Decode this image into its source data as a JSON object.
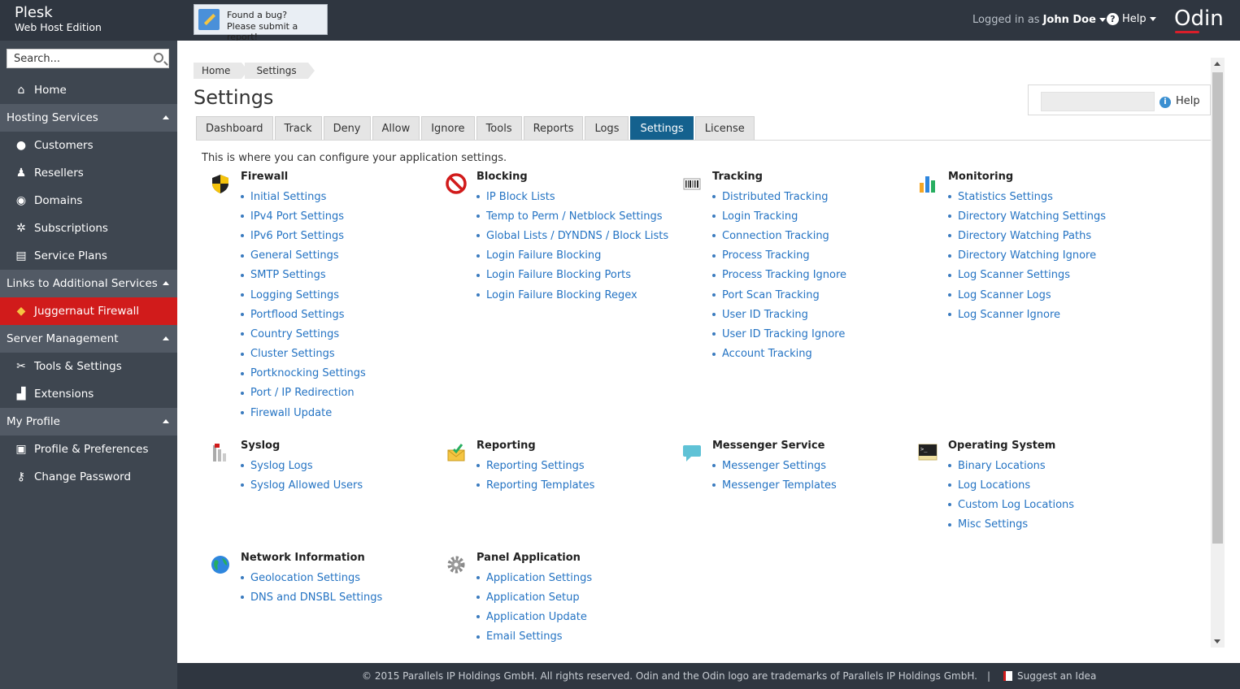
{
  "header": {
    "brand_line1": "Plesk",
    "brand_line2": "Web Host Edition",
    "bug_line1": "Found a bug?",
    "bug_line2": "Please submit a report!",
    "logged_in_as": "Logged in as",
    "user_name": "John Doe",
    "help_label": "Help",
    "logo": "Odin"
  },
  "sidebar": {
    "search_placeholder": "Search...",
    "home": "Home",
    "sections": [
      {
        "label": "Hosting Services",
        "items": [
          "Customers",
          "Resellers",
          "Domains",
          "Subscriptions",
          "Service Plans"
        ]
      },
      {
        "label": "Links to Additional Services",
        "items": [
          "Juggernaut Firewall"
        ]
      },
      {
        "label": "Server Management",
        "items": [
          "Tools & Settings",
          "Extensions"
        ]
      },
      {
        "label": "My Profile",
        "items": [
          "Profile & Preferences",
          "Change Password"
        ]
      }
    ]
  },
  "main": {
    "breadcrumbs": [
      "Home",
      "Settings"
    ],
    "title": "Settings",
    "help_label": "Help",
    "tabs": [
      "Dashboard",
      "Track",
      "Deny",
      "Allow",
      "Ignore",
      "Tools",
      "Reports",
      "Logs",
      "Settings",
      "License"
    ],
    "active_tab": "Settings",
    "intro": "This is where you can configure your application settings.",
    "groups": [
      {
        "title": "Firewall",
        "icon": "shield-icon",
        "links": [
          "Initial Settings",
          "IPv4 Port Settings",
          "IPv6 Port Settings",
          "General Settings",
          "SMTP Settings",
          "Logging Settings",
          "Portflood Settings",
          "Country Settings",
          "Cluster Settings",
          "Portknocking Settings",
          "Port / IP Redirection",
          "Firewall Update"
        ]
      },
      {
        "title": "Blocking",
        "icon": "block-icon",
        "links": [
          "IP Block Lists",
          "Temp to Perm / Netblock Settings",
          "Global Lists / DYNDNS / Block Lists",
          "Login Failure Blocking",
          "Login Failure Blocking Ports",
          "Login Failure Blocking Regex"
        ]
      },
      {
        "title": "Tracking",
        "icon": "barcode-icon",
        "links": [
          "Distributed Tracking",
          "Login Tracking",
          "Connection Tracking",
          "Process Tracking",
          "Process Tracking Ignore",
          "Port Scan Tracking",
          "User ID Tracking",
          "User ID Tracking Ignore",
          "Account Tracking"
        ]
      },
      {
        "title": "Monitoring",
        "icon": "bar-chart-icon",
        "links": [
          "Statistics Settings",
          "Directory Watching Settings",
          "Directory Watching Paths",
          "Directory Watching Ignore",
          "Log Scanner Settings",
          "Log Scanner Logs",
          "Log Scanner Ignore"
        ]
      },
      {
        "title": "Syslog",
        "icon": "syslog-icon",
        "links": [
          "Syslog Logs",
          "Syslog Allowed Users"
        ]
      },
      {
        "title": "Reporting",
        "icon": "mail-icon",
        "links": [
          "Reporting Settings",
          "Reporting Templates"
        ]
      },
      {
        "title": "Messenger Service",
        "icon": "chat-icon",
        "links": [
          "Messenger Settings",
          "Messenger Templates"
        ]
      },
      {
        "title": "Operating System",
        "icon": "terminal-icon",
        "links": [
          "Binary Locations",
          "Log Locations",
          "Custom Log Locations",
          "Misc Settings"
        ]
      },
      {
        "title": "Network Information",
        "icon": "globe-icon",
        "links": [
          "Geolocation Settings",
          "DNS and DNSBL Settings"
        ]
      },
      {
        "title": "Panel Application",
        "icon": "gear-icon",
        "links": [
          "Application Settings",
          "Application Setup",
          "Application Update",
          "Email Settings"
        ]
      }
    ]
  },
  "footer": {
    "copyright": "© 2015 Parallels IP Holdings GmbH. All rights reserved. Odin and the Odin logo are trademarks of Parallels IP Holdings GmbH.",
    "separator": "|",
    "suggest": "Suggest an Idea"
  }
}
